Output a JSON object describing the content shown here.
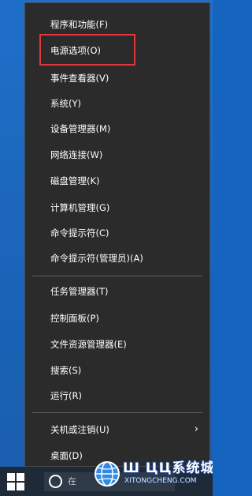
{
  "menu": {
    "items": [
      {
        "label": "程序和功能(F)"
      },
      {
        "label": "电源选项(O)"
      },
      {
        "label": "事件查看器(V)"
      },
      {
        "label": "系统(Y)"
      },
      {
        "label": "设备管理器(M)"
      },
      {
        "label": "网络连接(W)"
      },
      {
        "label": "磁盘管理(K)"
      },
      {
        "label": "计算机管理(G)"
      },
      {
        "label": "命令提示符(C)"
      },
      {
        "label": "命令提示符(管理员)(A)"
      },
      {
        "label": "任务管理器(T)"
      },
      {
        "label": "控制面板(P)"
      },
      {
        "label": "文件资源管理器(E)"
      },
      {
        "label": "搜索(S)"
      },
      {
        "label": "运行(R)"
      },
      {
        "label": "关机或注销(U)"
      },
      {
        "label": "桌面(D)"
      }
    ],
    "highlighted_index": 1,
    "submenu_arrow": "›"
  },
  "taskbar": {
    "search_text": "在"
  },
  "watermark": {
    "title": "Ш ЦЦ系统城",
    "subtitle": "XITONGCHENG.COM"
  },
  "colors": {
    "menu_bg": "#2b2b2b",
    "highlight": "#e0373a",
    "desktop": "#1a63b7",
    "taskbar": "#1f2a38"
  }
}
